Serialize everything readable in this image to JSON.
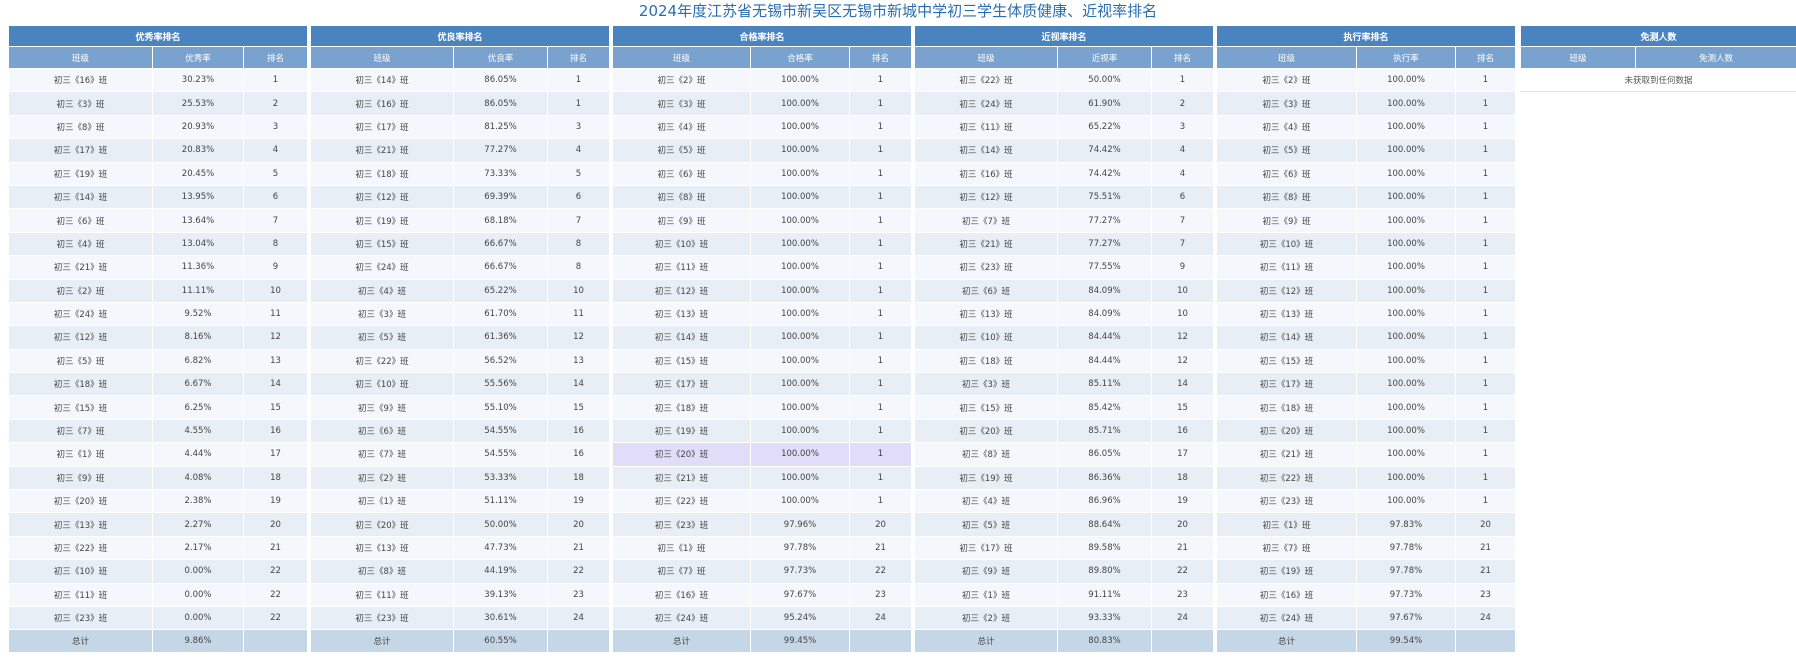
{
  "title": "2024年度江苏省无锡市新吴区无锡市新城中学初三学生体质健康、近视率排名",
  "tables": [
    {
      "id": "excellent",
      "header": "优秀率排名",
      "columns": [
        "班级",
        "优秀率",
        "排名"
      ],
      "rows": [
        [
          "初三《16》班",
          "30.23%",
          "1"
        ],
        [
          "初三《3》班",
          "25.53%",
          "2"
        ],
        [
          "初三《8》班",
          "20.93%",
          "3"
        ],
        [
          "初三《17》班",
          "20.83%",
          "4"
        ],
        [
          "初三《19》班",
          "20.45%",
          "5"
        ],
        [
          "初三《14》班",
          "13.95%",
          "6"
        ],
        [
          "初三《6》班",
          "13.64%",
          "7"
        ],
        [
          "初三《4》班",
          "13.04%",
          "8"
        ],
        [
          "初三《21》班",
          "11.36%",
          "9"
        ],
        [
          "初三《2》班",
          "11.11%",
          "10"
        ],
        [
          "初三《24》班",
          "9.52%",
          "11"
        ],
        [
          "初三《12》班",
          "8.16%",
          "12"
        ],
        [
          "初三《5》班",
          "6.82%",
          "13"
        ],
        [
          "初三《18》班",
          "6.67%",
          "14"
        ],
        [
          "初三《15》班",
          "6.25%",
          "15"
        ],
        [
          "初三《7》班",
          "4.55%",
          "16"
        ],
        [
          "初三《1》班",
          "4.44%",
          "17"
        ],
        [
          "初三《9》班",
          "4.08%",
          "18"
        ],
        [
          "初三《20》班",
          "2.38%",
          "19"
        ],
        [
          "初三《13》班",
          "2.27%",
          "20"
        ],
        [
          "初三《22》班",
          "2.17%",
          "21"
        ],
        [
          "初三《10》班",
          "0.00%",
          "22"
        ],
        [
          "初三《11》班",
          "0.00%",
          "22"
        ],
        [
          "初三《23》班",
          "0.00%",
          "22"
        ]
      ],
      "total": [
        "总计",
        "9.86%",
        ""
      ]
    },
    {
      "id": "good",
      "header": "优良率排名",
      "columns": [
        "班级",
        "优良率",
        "排名"
      ],
      "rows": [
        [
          "初三《14》班",
          "86.05%",
          "1"
        ],
        [
          "初三《16》班",
          "86.05%",
          "1"
        ],
        [
          "初三《17》班",
          "81.25%",
          "3"
        ],
        [
          "初三《21》班",
          "77.27%",
          "4"
        ],
        [
          "初三《18》班",
          "73.33%",
          "5"
        ],
        [
          "初三《12》班",
          "69.39%",
          "6"
        ],
        [
          "初三《19》班",
          "68.18%",
          "7"
        ],
        [
          "初三《15》班",
          "66.67%",
          "8"
        ],
        [
          "初三《24》班",
          "66.67%",
          "8"
        ],
        [
          "初三《4》班",
          "65.22%",
          "10"
        ],
        [
          "初三《3》班",
          "61.70%",
          "11"
        ],
        [
          "初三《5》班",
          "61.36%",
          "12"
        ],
        [
          "初三《22》班",
          "56.52%",
          "13"
        ],
        [
          "初三《10》班",
          "55.56%",
          "14"
        ],
        [
          "初三《9》班",
          "55.10%",
          "15"
        ],
        [
          "初三《6》班",
          "54.55%",
          "16"
        ],
        [
          "初三《7》班",
          "54.55%",
          "16"
        ],
        [
          "初三《2》班",
          "53.33%",
          "18"
        ],
        [
          "初三《1》班",
          "51.11%",
          "19"
        ],
        [
          "初三《20》班",
          "50.00%",
          "20"
        ],
        [
          "初三《13》班",
          "47.73%",
          "21"
        ],
        [
          "初三《8》班",
          "44.19%",
          "22"
        ],
        [
          "初三《11》班",
          "39.13%",
          "23"
        ],
        [
          "初三《23》班",
          "30.61%",
          "24"
        ]
      ],
      "total": [
        "总计",
        "60.55%",
        ""
      ]
    },
    {
      "id": "pass",
      "header": "合格率排名",
      "columns": [
        "班级",
        "合格率",
        "排名"
      ],
      "rows": [
        [
          "初三《2》班",
          "100.00%",
          "1"
        ],
        [
          "初三《3》班",
          "100.00%",
          "1"
        ],
        [
          "初三《4》班",
          "100.00%",
          "1"
        ],
        [
          "初三《5》班",
          "100.00%",
          "1"
        ],
        [
          "初三《6》班",
          "100.00%",
          "1"
        ],
        [
          "初三《8》班",
          "100.00%",
          "1"
        ],
        [
          "初三《9》班",
          "100.00%",
          "1"
        ],
        [
          "初三《10》班",
          "100.00%",
          "1"
        ],
        [
          "初三《11》班",
          "100.00%",
          "1"
        ],
        [
          "初三《12》班",
          "100.00%",
          "1"
        ],
        [
          "初三《13》班",
          "100.00%",
          "1"
        ],
        [
          "初三《14》班",
          "100.00%",
          "1"
        ],
        [
          "初三《15》班",
          "100.00%",
          "1"
        ],
        [
          "初三《17》班",
          "100.00%",
          "1"
        ],
        [
          "初三《18》班",
          "100.00%",
          "1"
        ],
        [
          "初三《19》班",
          "100.00%",
          "1"
        ],
        [
          "初三《20》班",
          "100.00%",
          "1"
        ],
        [
          "初三《21》班",
          "100.00%",
          "1"
        ],
        [
          "初三《22》班",
          "100.00%",
          "1"
        ],
        [
          "初三《23》班",
          "97.96%",
          "20"
        ],
        [
          "初三《1》班",
          "97.78%",
          "21"
        ],
        [
          "初三《7》班",
          "97.73%",
          "22"
        ],
        [
          "初三《16》班",
          "97.67%",
          "23"
        ],
        [
          "初三《24》班",
          "95.24%",
          "24"
        ]
      ],
      "total": [
        "总计",
        "99.45%",
        ""
      ],
      "highlight_row": "初三《20》班"
    },
    {
      "id": "myopia",
      "header": "近视率排名",
      "columns": [
        "班级",
        "近视率",
        "排名"
      ],
      "rows": [
        [
          "初三《22》班",
          "50.00%",
          "1"
        ],
        [
          "初三《24》班",
          "61.90%",
          "2"
        ],
        [
          "初三《11》班",
          "65.22%",
          "3"
        ],
        [
          "初三《14》班",
          "74.42%",
          "4"
        ],
        [
          "初三《16》班",
          "74.42%",
          "4"
        ],
        [
          "初三《12》班",
          "75.51%",
          "6"
        ],
        [
          "初三《7》班",
          "77.27%",
          "7"
        ],
        [
          "初三《21》班",
          "77.27%",
          "7"
        ],
        [
          "初三《23》班",
          "77.55%",
          "9"
        ],
        [
          "初三《6》班",
          "84.09%",
          "10"
        ],
        [
          "初三《13》班",
          "84.09%",
          "10"
        ],
        [
          "初三《10》班",
          "84.44%",
          "12"
        ],
        [
          "初三《18》班",
          "84.44%",
          "12"
        ],
        [
          "初三《3》班",
          "85.11%",
          "14"
        ],
        [
          "初三《15》班",
          "85.42%",
          "15"
        ],
        [
          "初三《20》班",
          "85.71%",
          "16"
        ],
        [
          "初三《8》班",
          "86.05%",
          "17"
        ],
        [
          "初三《19》班",
          "86.36%",
          "18"
        ],
        [
          "初三《4》班",
          "86.96%",
          "19"
        ],
        [
          "初三《5》班",
          "88.64%",
          "20"
        ],
        [
          "初三《17》班",
          "89.58%",
          "21"
        ],
        [
          "初三《9》班",
          "89.80%",
          "22"
        ],
        [
          "初三《1》班",
          "91.11%",
          "23"
        ],
        [
          "初三《2》班",
          "93.33%",
          "24"
        ]
      ],
      "total": [
        "总计",
        "80.83%",
        ""
      ]
    },
    {
      "id": "execution",
      "header": "执行率排名",
      "columns": [
        "班级",
        "执行率",
        "排名"
      ],
      "rows": [
        [
          "初三《2》班",
          "100.00%",
          "1"
        ],
        [
          "初三《3》班",
          "100.00%",
          "1"
        ],
        [
          "初三《4》班",
          "100.00%",
          "1"
        ],
        [
          "初三《5》班",
          "100.00%",
          "1"
        ],
        [
          "初三《6》班",
          "100.00%",
          "1"
        ],
        [
          "初三《8》班",
          "100.00%",
          "1"
        ],
        [
          "初三《9》班",
          "100.00%",
          "1"
        ],
        [
          "初三《10》班",
          "100.00%",
          "1"
        ],
        [
          "初三《11》班",
          "100.00%",
          "1"
        ],
        [
          "初三《12》班",
          "100.00%",
          "1"
        ],
        [
          "初三《13》班",
          "100.00%",
          "1"
        ],
        [
          "初三《14》班",
          "100.00%",
          "1"
        ],
        [
          "初三《15》班",
          "100.00%",
          "1"
        ],
        [
          "初三《17》班",
          "100.00%",
          "1"
        ],
        [
          "初三《18》班",
          "100.00%",
          "1"
        ],
        [
          "初三《20》班",
          "100.00%",
          "1"
        ],
        [
          "初三《21》班",
          "100.00%",
          "1"
        ],
        [
          "初三《22》班",
          "100.00%",
          "1"
        ],
        [
          "初三《23》班",
          "100.00%",
          "1"
        ],
        [
          "初三《1》班",
          "97.83%",
          "20"
        ],
        [
          "初三《7》班",
          "97.78%",
          "21"
        ],
        [
          "初三《19》班",
          "97.78%",
          "21"
        ],
        [
          "初三《16》班",
          "97.73%",
          "23"
        ],
        [
          "初三《24》班",
          "97.67%",
          "24"
        ]
      ],
      "total": [
        "总计",
        "99.54%",
        ""
      ]
    }
  ],
  "exempt": {
    "header": "免测人数",
    "columns": [
      "班级",
      "免测人数"
    ],
    "empty_text": "未获取到任何数据"
  }
}
